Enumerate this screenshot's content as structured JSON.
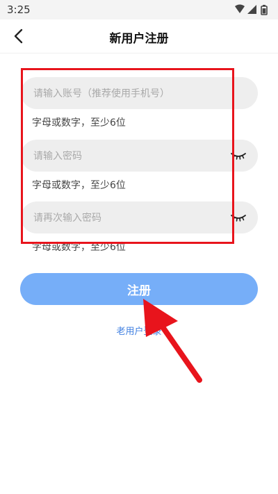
{
  "status_bar": {
    "time": "3:25",
    "icons": [
      "wifi-icon",
      "signal-icon",
      "battery-icon"
    ]
  },
  "header": {
    "title": "新用户注册",
    "back_icon": "back-arrow-icon"
  },
  "form": {
    "account": {
      "placeholder": "请输入账号（推荐使用手机号）",
      "value": "",
      "hint": "字母或数字，至少6位"
    },
    "password": {
      "placeholder": "请输入密码",
      "value": "",
      "hint": "字母或数字，至少6位",
      "toggle_icon": "eye-closed-icon"
    },
    "confirm_password": {
      "placeholder": "请再次输入密码",
      "value": "",
      "hint": "字母或数字，至少6位",
      "toggle_icon": "eye-closed-icon"
    }
  },
  "actions": {
    "register_label": "注册",
    "login_link_label": "老用户登录"
  },
  "colors": {
    "primary_button": "#76aef8",
    "link": "#3f7fe0",
    "annotation": "#e8141c",
    "field_background": "#eeeeee"
  }
}
